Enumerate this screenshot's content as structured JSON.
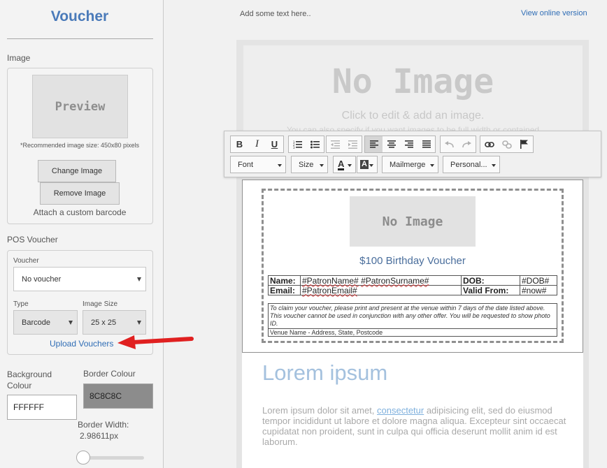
{
  "panel": {
    "title": "Voucher",
    "image_label": "Image",
    "preview_text": "Preview",
    "recommended_note": "*Recommended image size: 450x80 pixels",
    "change_image": "Change Image",
    "remove_image": "Remove Image",
    "attach_barcode": "Attach a custom barcode",
    "pos_voucher_label": "POS Voucher",
    "voucher_label": "Voucher",
    "voucher_value": "No voucher",
    "type_label": "Type",
    "type_value": "Barcode",
    "image_size_label": "Image Size",
    "image_size_value": "25 x 25",
    "upload_vouchers": "Upload Vouchers",
    "background_colour_label": "Background Colour",
    "background_colour_value": "FFFFFF",
    "border_colour_label": "Border Colour",
    "border_colour_value": "8C8C8C",
    "border_width_label": "Border Width:",
    "border_width_value": "2.98611px",
    "colors": {
      "accent": "#4a7ab9",
      "link": "#2f6db5",
      "arrow": "#e02020",
      "border_swatch": "#8c8c8c"
    }
  },
  "email": {
    "add_text": "Add some text here..",
    "view_online": "View online version",
    "no_image_big": "No Image",
    "no_image_sub": "Click to edit & add an image.",
    "no_image_sub2": "You can also specify if you want images to be full width or contained"
  },
  "toolbar": {
    "bold": "B",
    "italic": "I",
    "underline": "U",
    "font": "Font",
    "size": "Size",
    "text_color": "A",
    "bg_color": "A",
    "mailmerge": "Mailmerge",
    "personal": "Personal..."
  },
  "voucher": {
    "image_text": "No Image",
    "title": "$100 Birthday Voucher",
    "name_label": "Name:",
    "name_value_1": "#PatronName#",
    "name_value_2": "#PatronSurname#",
    "dob_label": "DOB:",
    "dob_value": "#DOB#",
    "email_label": "Email:",
    "email_value": "#PatronEmail#",
    "valid_label": "Valid From:",
    "valid_value": "#now#",
    "terms": "To claim your voucher, please print and present at the venue within 7 days of the date listed above. This voucher cannot be used in conjunction with any other offer. You will be requested to show photo ID.",
    "address": "Venue Name - Address, State, Postcode"
  },
  "content": {
    "heading": "Lorem ipsum",
    "para_before_link": "Lorem ipsum dolor sit amet, ",
    "para_link": "consectetur",
    "para_after_link": " adipisicing elit, sed do eiusmod tempor incididunt ut labore et dolore magna aliqua. Excepteur sint occaecat cupidatat non proident, sunt in culpa qui officia deserunt mollit anim id est laborum."
  }
}
